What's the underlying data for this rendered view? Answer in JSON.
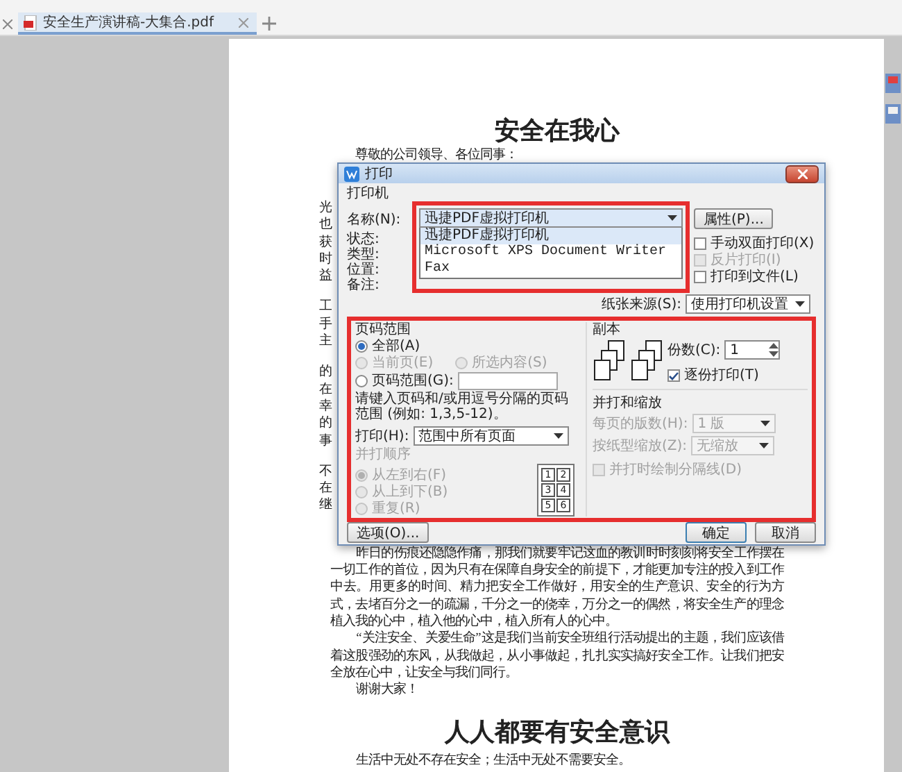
{
  "tab_bar": {
    "tabs": [
      {
        "label": "安全生产演讲稿-大集合.pdf",
        "selected": true
      }
    ]
  },
  "document": {
    "title": "安全在我心",
    "greeting": "尊敬的公司领导、各位同事：",
    "covered_fragments": [
      [
        "光",
        "也",
        "获",
        "时",
        "益"
      ],
      [
        "工",
        "手",
        "主"
      ],
      [
        "的",
        "在",
        "幸",
        "的",
        "事"
      ],
      [
        "不",
        "在",
        "继"
      ]
    ],
    "paragraphs": [
      "昨日的伤痕还隐隐作痛，那我们就要牢记这血的教训时时刻刻将安全工作摆在一切工作的首位，因为只有在保障自身安全的前提下，才能更加专注的投入到工作中去。用更多的时间、精力把安全工作做好，用安全的生产意识、安全的行为方式，去堵百分之一的疏漏，千分之一的侥幸，万分之一的偶然，将安全生产的理念植入我的心中，植入他的心中，植入所有人的心中。",
      "“关注安全、关爱生命”这是我们当前安全班组行活动提出的主题，我们应该借着这股强劲的东风，从我做起，从小事做起，扎扎实实搞好安全工作。让我们把安全放在心中，让安全与我们同行。",
      "谢谢大家！"
    ],
    "heading2": "人人都要有安全意识",
    "last_line": "生活中无处不存在安全；生活中无处不需要安全。"
  },
  "print_dialog": {
    "title": "打印",
    "printer_group": "打印机",
    "name_label": "名称(N):",
    "printer": "迅捷PDF虚拟打印机",
    "properties_button": "属性(P)...",
    "printer_options": [
      {
        "label": "迅捷PDF虚拟打印机",
        "selected": true
      },
      {
        "label": "Microsoft XPS Document Writer",
        "selected": false
      },
      {
        "label": "Fax",
        "selected": false
      }
    ],
    "info_labels": [
      "状态:",
      "类型:",
      "位置:",
      "备注:"
    ],
    "checkboxes": [
      {
        "label": "手动双面打印(X)",
        "checked": false,
        "disabled": false
      },
      {
        "label": "反片打印(I)",
        "checked": false,
        "disabled": true
      },
      {
        "label": "打印到文件(L)",
        "checked": false,
        "disabled": false
      }
    ],
    "paper_source_label": "纸张来源(S):",
    "paper_source": "使用打印机设置",
    "page_range": {
      "title": "页码范围",
      "options": [
        {
          "label": "全部(A)",
          "selected": true,
          "disabled": false
        },
        {
          "label": "当前页(E)",
          "selected": false,
          "disabled": true
        },
        {
          "label": "所选内容(S)",
          "selected": false,
          "disabled": true
        },
        {
          "label": "页码范围(G):",
          "selected": false,
          "disabled": false
        }
      ],
      "hint": "请键入页码和/或用逗号分隔的页码范围 (例如: 1,3,5-12)。"
    },
    "print_what_label": "打印(H):",
    "print_what": "范围中所有页面",
    "collate_order": {
      "title": "并打顺序",
      "disabled": true,
      "options": [
        {
          "label": "从左到右(F)",
          "selected": true
        },
        {
          "label": "从上到下(B)",
          "selected": false
        },
        {
          "label": "重复(R)",
          "selected": false
        }
      ],
      "grid": [
        "1",
        "2",
        "3",
        "4",
        "5",
        "6"
      ]
    },
    "copies": {
      "title": "副本",
      "count_label": "份数(C):",
      "count": "1",
      "collate": {
        "label": "逐份打印(T)",
        "checked": true
      }
    },
    "zoom": {
      "title": "并打和缩放",
      "pages_per_sheet_label": "每页的版数(H):",
      "pages_per_sheet": "1 版",
      "scale_label": "按纸型缩放(Z):",
      "scale": "无缩放",
      "separator": {
        "label": "并打时绘制分隔线(D)",
        "checked": false,
        "disabled": true
      }
    },
    "buttons": {
      "options": "选项(O)...",
      "ok": "确定",
      "cancel": "取消"
    }
  }
}
